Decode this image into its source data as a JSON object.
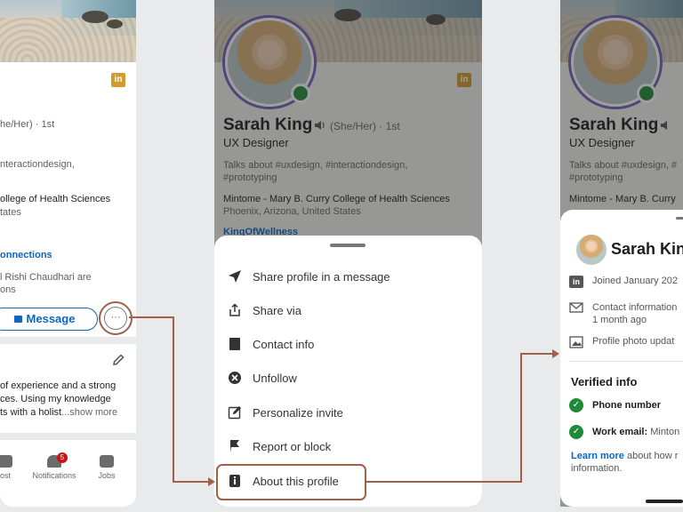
{
  "screen1": {
    "pronoun_line": "he/Her) · 1st",
    "talks_line": "nteractiondesign,",
    "edu_line1": "ollege of Health Sciences",
    "edu_line2": "tates",
    "connections_label": "onnections",
    "mutual_line1": "l Rishi Chaudhari are",
    "mutual_line2": "ons",
    "message_label": "Message",
    "more_glyph": "···",
    "about_line1": "of experience and a strong",
    "about_line2": "ces. Using my knowledge",
    "about_line3": "ts with a holist",
    "show_more": "...show more",
    "tabs": [
      {
        "label": "ost"
      },
      {
        "label": "Notifications",
        "badge": "5"
      },
      {
        "label": "Jobs"
      }
    ]
  },
  "screen2": {
    "name": "Sarah King",
    "pronouns": "(She/Her) · 1st",
    "headline": "UX Designer",
    "talks_line1": "Talks about #uxdesign, #interactiondesign,",
    "talks_line2": "#prototyping",
    "edu_line": "Mintome - Mary B. Curry College of Health Sciences",
    "location": "Phoenix, Arizona, United States",
    "website": "KingOfWellness",
    "linkedin_badge": "in",
    "menu": [
      {
        "label": "Share profile in a message",
        "icon": "send-icon"
      },
      {
        "label": "Share via",
        "icon": "share-icon"
      },
      {
        "label": "Contact info",
        "icon": "contact-card-icon"
      },
      {
        "label": "Unfollow",
        "icon": "unfollow-icon"
      },
      {
        "label": "Personalize invite",
        "icon": "edit-icon"
      },
      {
        "label": "Report or block",
        "icon": "flag-icon"
      },
      {
        "label": "About this profile",
        "icon": "info-icon"
      }
    ]
  },
  "screen3": {
    "name": "Sarah King",
    "headline": "UX Designer",
    "talks_line1": "Talks about #uxdesign, #",
    "talks_line2": "#prototyping",
    "edu_line": "Mintome - Mary B. Curry",
    "panel_name": "Sarah Kin",
    "joined": "Joined January 202",
    "contact_line1": "Contact information",
    "contact_line2": "1 month ago",
    "photo_line": "Profile photo updat",
    "verified_title": "Verified info",
    "phone": "Phone number",
    "work_email_label": "Work email:",
    "work_email_value": " Minton",
    "learn_more": "Learn more",
    "learn_rest": " about how r",
    "information": "information."
  },
  "colors": {
    "accent_blue": "#0a66c2",
    "highlight": "#a0604a",
    "online_green": "#1f8b3a",
    "verified_green": "#1f8b3a",
    "linkedin_badge": "#d49a2b"
  }
}
